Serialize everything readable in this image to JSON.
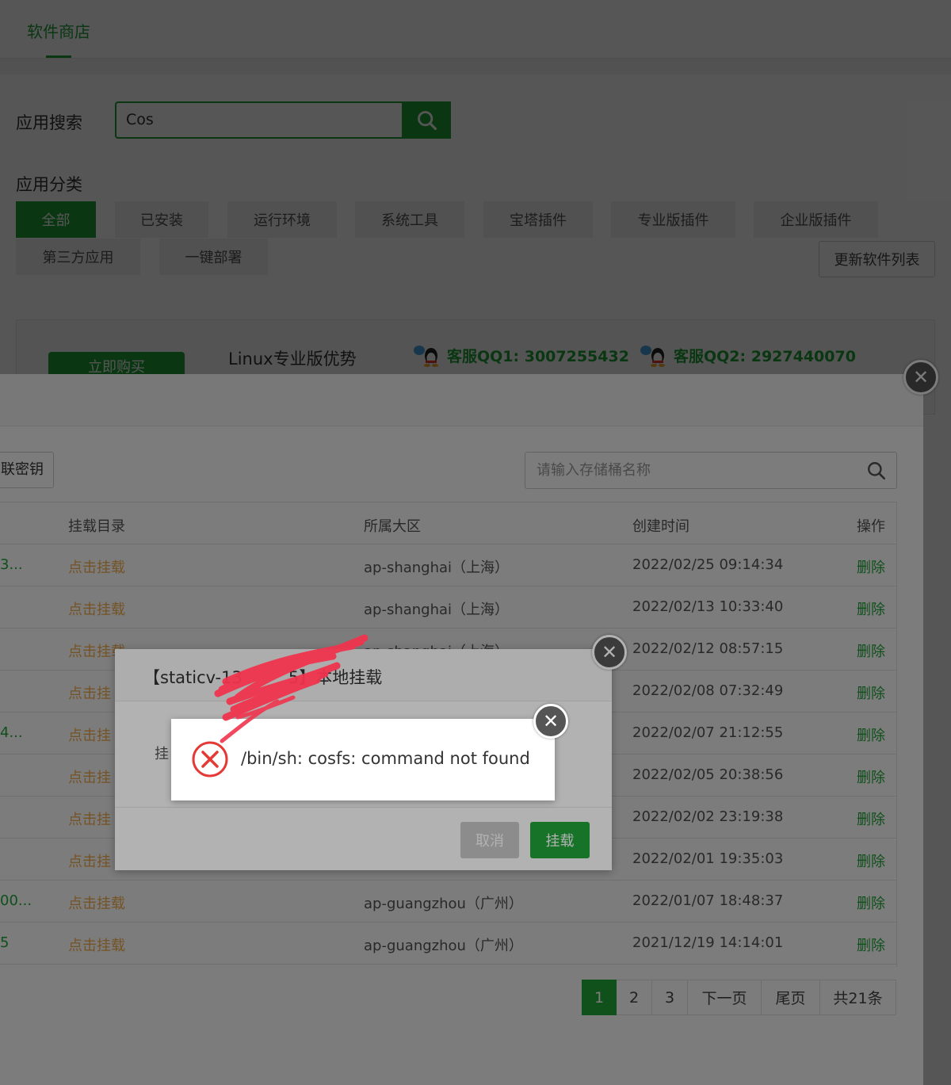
{
  "top_nav": {
    "tab": "软件商店"
  },
  "search": {
    "label": "应用搜索",
    "value": "Cos"
  },
  "categories": {
    "label": "应用分类",
    "items": [
      "全部",
      "已安装",
      "运行环境",
      "系统工具",
      "宝塔插件",
      "专业版插件",
      "企业版插件",
      "第三方应用",
      "一键部署"
    ],
    "update_label": "更新软件列表"
  },
  "promo": {
    "buy_label": "立即购买",
    "title": "Linux专业版优势",
    "qq1": "客服QQ1: 3007255432",
    "qq2": "客服QQ2: 2927440070"
  },
  "cos_panel": {
    "key_button": "联密钥",
    "search_placeholder": "请输入存储桶名称",
    "columns": {
      "mount": "挂载目录",
      "region": "所属大区",
      "time": "创建时间",
      "op": "操作"
    },
    "rows": [
      {
        "name": "3...",
        "mount": "点击挂载",
        "region": "ap-shanghai（上海）",
        "time": "2022/02/25 09:14:34",
        "op": "删除"
      },
      {
        "name": "",
        "mount": "点击挂载",
        "region": "ap-shanghai（上海）",
        "time": "2022/02/13 10:33:40",
        "op": "删除"
      },
      {
        "name": "",
        "mount": "点击挂载",
        "region": "ap-shanghai（上海）",
        "time": "2022/02/12 08:57:15",
        "op": "删除"
      },
      {
        "name": "",
        "mount": "点击挂",
        "region": "",
        "time": "2022/02/08 07:32:49",
        "op": "删除"
      },
      {
        "name": "4...",
        "mount": "点击挂",
        "region": "",
        "time": "2022/02/07 21:12:55",
        "op": "删除"
      },
      {
        "name": "",
        "mount": "点击挂",
        "region": "",
        "time": "2022/02/05 20:38:56",
        "op": "删除"
      },
      {
        "name": "",
        "mount": "点击挂",
        "region": "",
        "time": "2022/02/02 23:19:38",
        "op": "删除"
      },
      {
        "name": "",
        "mount": "点击挂",
        "region": "",
        "time": "2022/02/01 19:35:03",
        "op": "删除"
      },
      {
        "name": "00...",
        "mount": "点击挂载",
        "region": "ap-guangzhou（广州）",
        "time": "2022/01/07 18:48:37",
        "op": "删除"
      },
      {
        "name": "5",
        "mount": "点击挂载",
        "region": "ap-guangzhou（广州）",
        "time": "2021/12/19 14:14:01",
        "op": "删除"
      }
    ],
    "pager": {
      "p1": "1",
      "p2": "2",
      "p3": "3",
      "next": "下一页",
      "last": "尾页",
      "total": "共21条"
    }
  },
  "mount_dialog": {
    "title": "【staticv-13",
    "title_suffix": "5】本地挂载",
    "field_label": "挂",
    "cancel": "取消",
    "confirm": "挂载"
  },
  "error_toast": {
    "message": "/bin/sh: cosfs: command not found"
  },
  "colors": {
    "accent": "#20a53a",
    "link_orange": "#f0ad4e",
    "error_red": "#e53935",
    "scribble": "#f0344e"
  },
  "icons": [
    "search-icon",
    "qq-icon",
    "close-icon",
    "error-icon"
  ]
}
